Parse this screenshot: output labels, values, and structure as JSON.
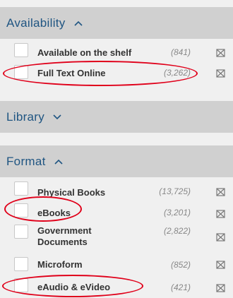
{
  "facets": {
    "availability": {
      "title": "Availability",
      "expanded": true,
      "items": [
        {
          "label": "Available on the shelf",
          "count": "(841)"
        },
        {
          "label": "Full Text Online",
          "count": "(3,262)"
        }
      ]
    },
    "library": {
      "title": "Library",
      "expanded": false
    },
    "format": {
      "title": "Format",
      "expanded": true,
      "items": [
        {
          "label": "Physical Books",
          "count": "(13,725)"
        },
        {
          "label": "eBooks",
          "count": "(3,201)"
        },
        {
          "label": "Government Documents",
          "count": "(2,822)"
        },
        {
          "label": "Microform",
          "count": "(852)"
        },
        {
          "label": "eAudio & eVideo",
          "count": "(421)"
        }
      ]
    }
  },
  "colors": {
    "header_bg": "#d0d0d0",
    "title_text": "#1f5582",
    "highlight_circle": "#e0001a"
  },
  "icons": {
    "expanded": "chevron-up-icon",
    "collapsed": "chevron-down-icon",
    "exclude": "exclude-icon"
  }
}
